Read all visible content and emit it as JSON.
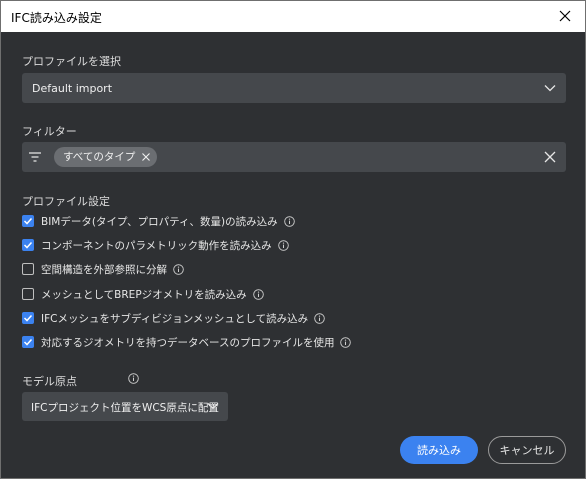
{
  "window": {
    "title": "IFC読み込み設定"
  },
  "profile": {
    "label": "プロファイルを選択",
    "selected": "Default import"
  },
  "filter": {
    "label": "フィルター",
    "chip": "すべてのタイプ"
  },
  "settings": {
    "label": "プロファイル設定",
    "options": [
      {
        "text": "BIMデータ(タイプ、プロパティ、数量)の読み込み",
        "checked": true
      },
      {
        "text": "コンポーネントのパラメトリック動作を読み込み",
        "checked": true
      },
      {
        "text": "空間構造を外部参照に分解",
        "checked": false
      },
      {
        "text": "メッシュとしてBREPジオメトリを読み込み",
        "checked": false
      },
      {
        "text": "IFCメッシュをサブディビジョンメッシュとして読み込み",
        "checked": true
      },
      {
        "text": "対応するジオメトリを持つデータベースのプロファイルを使用",
        "checked": true
      }
    ]
  },
  "origin": {
    "label": "モデル原点",
    "selected": "IFCプロジェクト位置をWCS原点に配置"
  },
  "buttons": {
    "import": "読み込み",
    "cancel": "キャンセル"
  },
  "colors": {
    "accent": "#3b82f0",
    "background": "#2e3033",
    "field": "#45484c"
  },
  "icons": [
    "close-icon",
    "chevron-down-icon",
    "filter-icon",
    "clear-icon",
    "checkbox-icon",
    "info-icon"
  ]
}
